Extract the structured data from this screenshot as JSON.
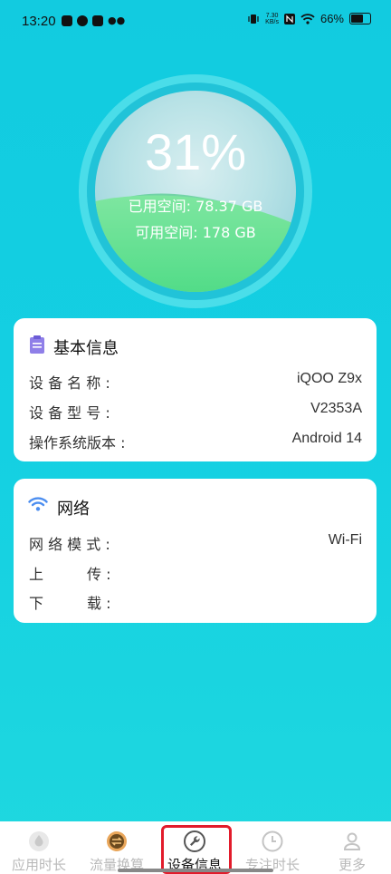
{
  "status_bar": {
    "time": "13:20",
    "net_speed_value": "7.30",
    "net_speed_unit": "KB/s",
    "battery": "66%"
  },
  "storage": {
    "percent": "31%",
    "used_label": "已用空间:",
    "used_value": "78.37 GB",
    "free_label": "可用空间:",
    "free_value": "178 GB",
    "used_fraction": 0.31
  },
  "basic_info": {
    "title": "基本信息",
    "rows": [
      {
        "label": "设 备 名 称 :",
        "value": "iQOO Z9x"
      },
      {
        "label": "设 备 型 号 :",
        "value": "V2353A"
      },
      {
        "label": "操作系统版本 :",
        "value": "Android 14"
      }
    ]
  },
  "network": {
    "title": "网络",
    "rows": [
      {
        "label": "网 络 模 式 :",
        "value": "Wi-Fi"
      },
      {
        "label": "上　　　传 :",
        "value": ""
      },
      {
        "label": "下　　　载 :",
        "value": ""
      }
    ]
  },
  "tabs": [
    {
      "label": "应用时长",
      "icon": "droplet-icon",
      "active": false
    },
    {
      "label": "流量换算",
      "icon": "exchange-icon",
      "active": false
    },
    {
      "label": "设备信息",
      "icon": "wrench-icon",
      "active": true
    },
    {
      "label": "专注时长",
      "icon": "clock-icon",
      "active": false
    },
    {
      "label": "更多",
      "icon": "person-icon",
      "active": false
    }
  ],
  "colors": {
    "background": "#12cbe0",
    "wave_green": "#5fe08e",
    "active_highlight": "#e21b2b",
    "card_icon_purple": "#8f7fe8",
    "wifi_blue": "#4c8ef0"
  }
}
